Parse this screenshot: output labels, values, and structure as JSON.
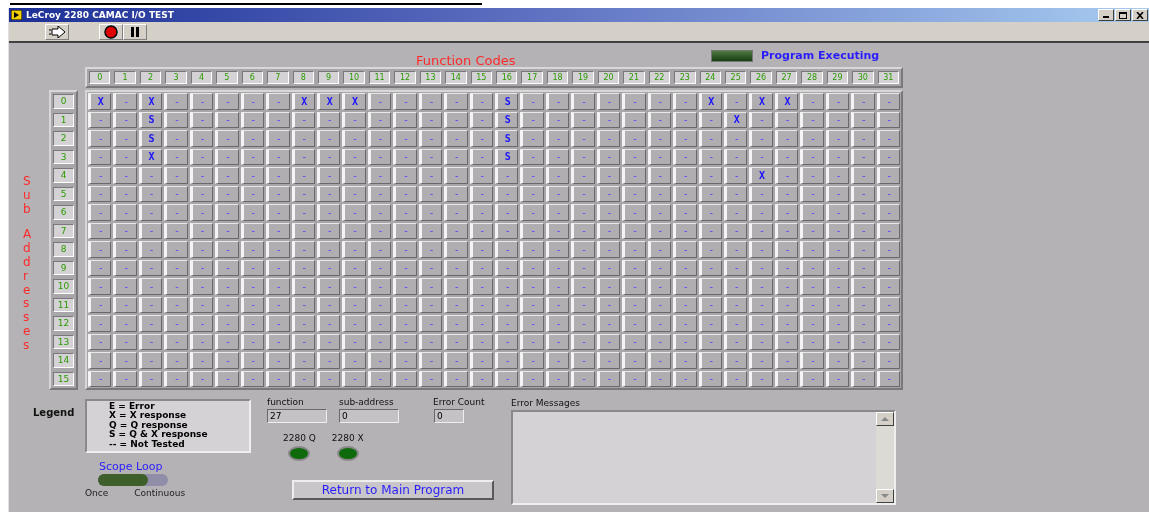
{
  "window": {
    "title": "LeCroy 2280 CAMAC I/O TEST"
  },
  "function_codes": {
    "title": "Function Codes",
    "columns": [
      "0",
      "1",
      "2",
      "3",
      "4",
      "5",
      "6",
      "7",
      "8",
      "9",
      "10",
      "11",
      "12",
      "13",
      "14",
      "15",
      "16",
      "17",
      "18",
      "19",
      "20",
      "21",
      "22",
      "23",
      "24",
      "25",
      "26",
      "27",
      "28",
      "29",
      "30",
      "31"
    ]
  },
  "program_executing": {
    "label": "Program Executing",
    "on": false
  },
  "sub_addresses": {
    "title": "Sub Addresses",
    "rows": [
      "0",
      "1",
      "2",
      "3",
      "4",
      "5",
      "6",
      "7",
      "8",
      "9",
      "10",
      "11",
      "12",
      "13",
      "14",
      "15"
    ]
  },
  "grid": [
    [
      "X",
      "-",
      "X",
      "-",
      "-",
      "-",
      "-",
      "-",
      "X",
      "X",
      "X",
      "-",
      "-",
      "-",
      "-",
      "-",
      "S",
      "-",
      "-",
      "-",
      "-",
      "-",
      "-",
      "-",
      "X",
      "-",
      "X",
      "X",
      "-",
      "-",
      "-",
      "-"
    ],
    [
      "-",
      "-",
      "S",
      "-",
      "-",
      "-",
      "-",
      "-",
      "-",
      "-",
      "-",
      "-",
      "-",
      "-",
      "-",
      "-",
      "S",
      "-",
      "-",
      "-",
      "-",
      "-",
      "-",
      "-",
      "-",
      "X",
      "-",
      "-",
      "-",
      "-",
      "-",
      "-"
    ],
    [
      "-",
      "-",
      "S",
      "-",
      "-",
      "-",
      "-",
      "-",
      "-",
      "-",
      "-",
      "-",
      "-",
      "-",
      "-",
      "-",
      "S",
      "-",
      "-",
      "-",
      "-",
      "-",
      "-",
      "-",
      "-",
      "-",
      "-",
      "-",
      "-",
      "-",
      "-",
      "-"
    ],
    [
      "-",
      "-",
      "X",
      "-",
      "-",
      "-",
      "-",
      "-",
      "-",
      "-",
      "-",
      "-",
      "-",
      "-",
      "-",
      "-",
      "S",
      "-",
      "-",
      "-",
      "-",
      "-",
      "-",
      "-",
      "-",
      "-",
      "-",
      "-",
      "-",
      "-",
      "-",
      "-"
    ],
    [
      "-",
      "-",
      "-",
      "-",
      "-",
      "-",
      "-",
      "-",
      "-",
      "-",
      "-",
      "-",
      "-",
      "-",
      "-",
      "-",
      "-",
      "-",
      "-",
      "-",
      "-",
      "-",
      "-",
      "-",
      "-",
      "-",
      "X",
      "-",
      "-",
      "-",
      "-",
      "-"
    ],
    [
      "-",
      "-",
      "-",
      "-",
      "-",
      "-",
      "-",
      "-",
      "-",
      "-",
      "-",
      "-",
      "-",
      "-",
      "-",
      "-",
      "-",
      "-",
      "-",
      "-",
      "-",
      "-",
      "-",
      "-",
      "-",
      "-",
      "-",
      "-",
      "-",
      "-",
      "-",
      "-"
    ],
    [
      "-",
      "-",
      "-",
      "-",
      "-",
      "-",
      "-",
      "-",
      "-",
      "-",
      "-",
      "-",
      "-",
      "-",
      "-",
      "-",
      "-",
      "-",
      "-",
      "-",
      "-",
      "-",
      "-",
      "-",
      "-",
      "-",
      "-",
      "-",
      "-",
      "-",
      "-",
      "-"
    ],
    [
      "-",
      "-",
      "-",
      "-",
      "-",
      "-",
      "-",
      "-",
      "-",
      "-",
      "-",
      "-",
      "-",
      "-",
      "-",
      "-",
      "-",
      "-",
      "-",
      "-",
      "-",
      "-",
      "-",
      "-",
      "-",
      "-",
      "-",
      "-",
      "-",
      "-",
      "-",
      "-"
    ],
    [
      "-",
      "-",
      "-",
      "-",
      "-",
      "-",
      "-",
      "-",
      "-",
      "-",
      "-",
      "-",
      "-",
      "-",
      "-",
      "-",
      "-",
      "-",
      "-",
      "-",
      "-",
      "-",
      "-",
      "-",
      "-",
      "-",
      "-",
      "-",
      "-",
      "-",
      "-",
      "-"
    ],
    [
      "-",
      "-",
      "-",
      "-",
      "-",
      "-",
      "-",
      "-",
      "-",
      "-",
      "-",
      "-",
      "-",
      "-",
      "-",
      "-",
      "-",
      "-",
      "-",
      "-",
      "-",
      "-",
      "-",
      "-",
      "-",
      "-",
      "-",
      "-",
      "-",
      "-",
      "-",
      "-"
    ],
    [
      "-",
      "-",
      "-",
      "-",
      "-",
      "-",
      "-",
      "-",
      "-",
      "-",
      "-",
      "-",
      "-",
      "-",
      "-",
      "-",
      "-",
      "-",
      "-",
      "-",
      "-",
      "-",
      "-",
      "-",
      "-",
      "-",
      "-",
      "-",
      "-",
      "-",
      "-",
      "-"
    ],
    [
      "-",
      "-",
      "-",
      "-",
      "-",
      "-",
      "-",
      "-",
      "-",
      "-",
      "-",
      "-",
      "-",
      "-",
      "-",
      "-",
      "-",
      "-",
      "-",
      "-",
      "-",
      "-",
      "-",
      "-",
      "-",
      "-",
      "-",
      "-",
      "-",
      "-",
      "-",
      "-"
    ],
    [
      "-",
      "-",
      "-",
      "-",
      "-",
      "-",
      "-",
      "-",
      "-",
      "-",
      "-",
      "-",
      "-",
      "-",
      "-",
      "-",
      "-",
      "-",
      "-",
      "-",
      "-",
      "-",
      "-",
      "-",
      "-",
      "-",
      "-",
      "-",
      "-",
      "-",
      "-",
      "-"
    ],
    [
      "-",
      "-",
      "-",
      "-",
      "-",
      "-",
      "-",
      "-",
      "-",
      "-",
      "-",
      "-",
      "-",
      "-",
      "-",
      "-",
      "-",
      "-",
      "-",
      "-",
      "-",
      "-",
      "-",
      "-",
      "-",
      "-",
      "-",
      "-",
      "-",
      "-",
      "-",
      "-"
    ],
    [
      "-",
      "-",
      "-",
      "-",
      "-",
      "-",
      "-",
      "-",
      "-",
      "-",
      "-",
      "-",
      "-",
      "-",
      "-",
      "-",
      "-",
      "-",
      "-",
      "-",
      "-",
      "-",
      "-",
      "-",
      "-",
      "-",
      "-",
      "-",
      "-",
      "-",
      "-",
      "-"
    ],
    [
      "-",
      "-",
      "-",
      "-",
      "-",
      "-",
      "-",
      "-",
      "-",
      "-",
      "-",
      "-",
      "-",
      "-",
      "-",
      "-",
      "-",
      "-",
      "-",
      "-",
      "-",
      "-",
      "-",
      "-",
      "-",
      "-",
      "-",
      "-",
      "-",
      "-",
      "-",
      "-"
    ]
  ],
  "legend": {
    "label": "Legend",
    "lines": [
      "E = Error",
      "X = X response",
      "Q = Q response",
      "S = Q & X response",
      "-- = Not Tested"
    ]
  },
  "function": {
    "label": "function",
    "value": "27"
  },
  "sub_address": {
    "label": "sub-address",
    "value": "0"
  },
  "error_count": {
    "label": "Error Count",
    "value": "0"
  },
  "leds": [
    {
      "label": "2280 Q",
      "on": false
    },
    {
      "label": "2280 X",
      "on": false
    }
  ],
  "scope_loop": {
    "label": "Scope Loop",
    "continuous": false,
    "options": [
      "Once",
      "Continuous"
    ]
  },
  "error_messages": {
    "label": "Error Messages"
  },
  "return_button": {
    "label": "Return to Main Program"
  }
}
